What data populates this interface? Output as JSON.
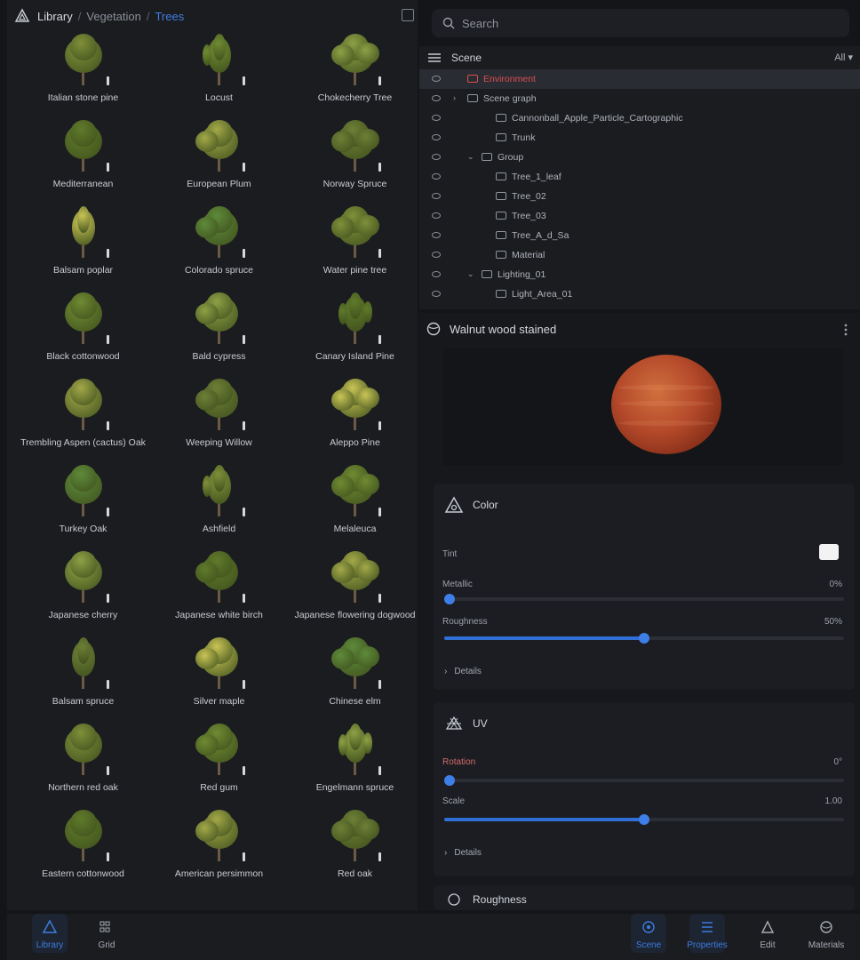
{
  "library": {
    "breadcrumb": [
      "Library",
      "Vegetation",
      "Trees"
    ],
    "items": [
      {
        "label": "Italian stone pine"
      },
      {
        "label": "Locust"
      },
      {
        "label": "Chokecherry Tree"
      },
      {
        "label": "Mediterranean"
      },
      {
        "label": "European Plum"
      },
      {
        "label": "Norway Spruce"
      },
      {
        "label": "Balsam poplar"
      },
      {
        "label": "Colorado spruce"
      },
      {
        "label": "Water pine tree"
      },
      {
        "label": "Black cottonwood"
      },
      {
        "label": "Bald cypress"
      },
      {
        "label": "Canary Island Pine"
      },
      {
        "label": "Trembling Aspen (cactus) Oak"
      },
      {
        "label": "Weeping Willow"
      },
      {
        "label": "Aleppo Pine"
      },
      {
        "label": "Turkey Oak"
      },
      {
        "label": "Ashfield"
      },
      {
        "label": "Melaleuca"
      },
      {
        "label": "Japanese cherry"
      },
      {
        "label": "Japanese white birch"
      },
      {
        "label": "Japanese flowering dogwood"
      },
      {
        "label": "Balsam spruce"
      },
      {
        "label": "Silver maple"
      },
      {
        "label": "Chinese elm"
      },
      {
        "label": "Northern red oak"
      },
      {
        "label": "Red gum"
      },
      {
        "label": "Engelmann spruce"
      },
      {
        "label": "Eastern cottonwood"
      },
      {
        "label": "American persimmon"
      },
      {
        "label": "Red oak"
      }
    ]
  },
  "search": {
    "placeholder": "Search"
  },
  "scene": {
    "title": "Scene",
    "filter": "All",
    "rows": [
      {
        "label": "Environment",
        "indent": 0,
        "selected": true,
        "caret": ""
      },
      {
        "label": "Scene graph",
        "indent": 0,
        "selected": false,
        "caret": "›"
      },
      {
        "label": "Cannonball_Apple_Particle_Cartographic",
        "indent": 2,
        "selected": false,
        "caret": ""
      },
      {
        "label": "Trunk",
        "indent": 2,
        "selected": false,
        "caret": ""
      },
      {
        "label": "Group",
        "indent": 1,
        "selected": false,
        "caret": "⌄"
      },
      {
        "label": "Tree_1_leaf",
        "indent": 2,
        "selected": false,
        "caret": ""
      },
      {
        "label": "Tree_02",
        "indent": 2,
        "selected": false,
        "caret": ""
      },
      {
        "label": "Tree_03",
        "indent": 2,
        "selected": false,
        "caret": ""
      },
      {
        "label": "Tree_A_d_Sa",
        "indent": 2,
        "selected": false,
        "caret": ""
      },
      {
        "label": "Material",
        "indent": 2,
        "selected": false,
        "caret": ""
      },
      {
        "label": "Lighting_01",
        "indent": 1,
        "selected": false,
        "caret": "⌄"
      },
      {
        "label": "Light_Area_01",
        "indent": 2,
        "selected": false,
        "caret": ""
      }
    ]
  },
  "material": {
    "title": "Walnut wood stained",
    "color": {
      "title": "Color",
      "tint_label": "Tint",
      "tint_color": "#f3f3f3",
      "metallic_label": "Metallic",
      "metallic_value": "0%",
      "metallic": 0.0,
      "roughness_label": "Roughness",
      "roughness_value": "50%",
      "roughness": 0.5,
      "more_label": "Details"
    },
    "uv": {
      "title": "UV",
      "rotation_label": "Rotation",
      "rotation_value": "0°",
      "rotation": 0.0,
      "scale_label": "Scale",
      "scale_value": "1.00",
      "scale": 0.5,
      "more_label": "Details"
    },
    "next_section": "Roughness"
  },
  "bottom_tabs": [
    {
      "label": "Library",
      "icon": "library-icon",
      "active": true
    },
    {
      "label": "Grid",
      "icon": "grid-icon",
      "active": false
    },
    {
      "label": "Scene",
      "icon": "scene-icon",
      "active": true
    },
    {
      "label": "Properties",
      "icon": "properties-icon",
      "active": true
    },
    {
      "label": "Edit",
      "icon": "edit-icon",
      "active": false
    },
    {
      "label": "Materials",
      "icon": "materials-icon",
      "active": false
    }
  ],
  "colors": {
    "accent": "#3f7fe0",
    "selected_text": "#d94f4f"
  }
}
